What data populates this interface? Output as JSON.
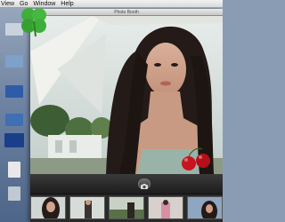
{
  "menubar": {
    "items": [
      "View",
      "Go",
      "Window",
      "Help"
    ]
  },
  "window": {
    "title": "Photo Booth"
  },
  "desktop": {
    "icons": [
      {
        "label": "",
        "color": "#c9d3de"
      },
      {
        "label": "",
        "color": "#2f5ca8"
      },
      {
        "label": "",
        "color": "#7fa0c8"
      },
      {
        "label": "",
        "color": "#3f6fb4"
      },
      {
        "label": "",
        "color": "#1a3f8a"
      },
      {
        "label": "",
        "color": "#e8e8e8"
      },
      {
        "label": "",
        "color": "#c0c8d2"
      }
    ]
  },
  "strip": {
    "thumbnail_count": 5,
    "status": ""
  },
  "colors": {
    "menubar": "#e6e6e6",
    "toolbar": "#2b2b2b",
    "cherries": "#c8141e",
    "clover": "#3fae3a"
  }
}
